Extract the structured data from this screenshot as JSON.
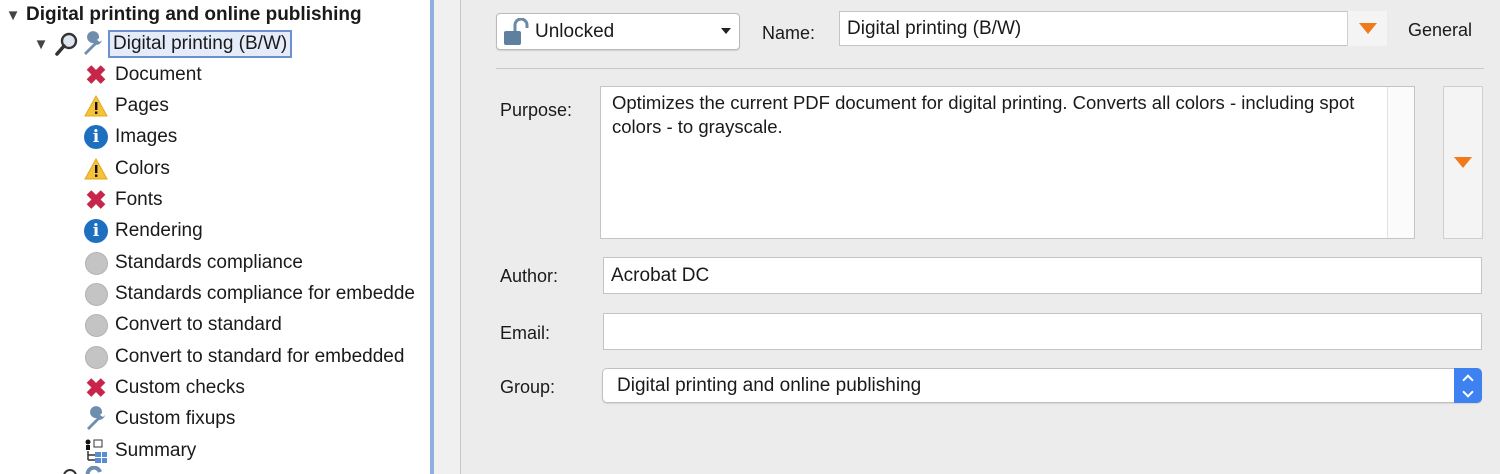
{
  "tree": {
    "root": {
      "label": "Digital printing and online publishing",
      "expanded": true
    },
    "preset": {
      "label": "Digital printing (B/W)",
      "expanded": true,
      "selected": true,
      "icons": [
        "magnifier-icon",
        "wrench-icon"
      ]
    },
    "items": [
      {
        "label": "Document",
        "icon": "error-x-icon"
      },
      {
        "label": "Pages",
        "icon": "warning-icon"
      },
      {
        "label": "Images",
        "icon": "info-icon"
      },
      {
        "label": "Colors",
        "icon": "warning-icon"
      },
      {
        "label": "Fonts",
        "icon": "error-x-icon"
      },
      {
        "label": "Rendering",
        "icon": "info-icon"
      },
      {
        "label": "Standards compliance",
        "icon": "inactive-dot-icon"
      },
      {
        "label": "Standards compliance for embedde",
        "icon": "inactive-dot-icon"
      },
      {
        "label": "Convert to standard",
        "icon": "inactive-dot-icon"
      },
      {
        "label": "Convert to standard for embedded",
        "icon": "inactive-dot-icon"
      },
      {
        "label": "Custom checks",
        "icon": "error-x-icon"
      },
      {
        "label": "Custom fixups",
        "icon": "wrench-icon"
      },
      {
        "label": "Summary",
        "icon": "summary-tree-icon"
      }
    ]
  },
  "form": {
    "lock": {
      "value": "Unlocked",
      "icon": "unlocked-padlock-icon"
    },
    "name": {
      "label": "Name:",
      "value": "Digital printing (B/W)"
    },
    "tab_label": "General",
    "purpose": {
      "label": "Purpose:",
      "value": "Optimizes the current PDF document for digital printing. Converts all colors - including spot colors - to grayscale."
    },
    "author": {
      "label": "Author:",
      "value": "Acrobat DC"
    },
    "email": {
      "label": "Email:",
      "value": ""
    },
    "group": {
      "label": "Group:",
      "value": "Digital printing and online publishing"
    }
  },
  "colors": {
    "accent_orange": "#f07a1a",
    "error_red": "#c8254a",
    "info_blue": "#1f6fc1",
    "select_blue": "#3d82f0"
  }
}
